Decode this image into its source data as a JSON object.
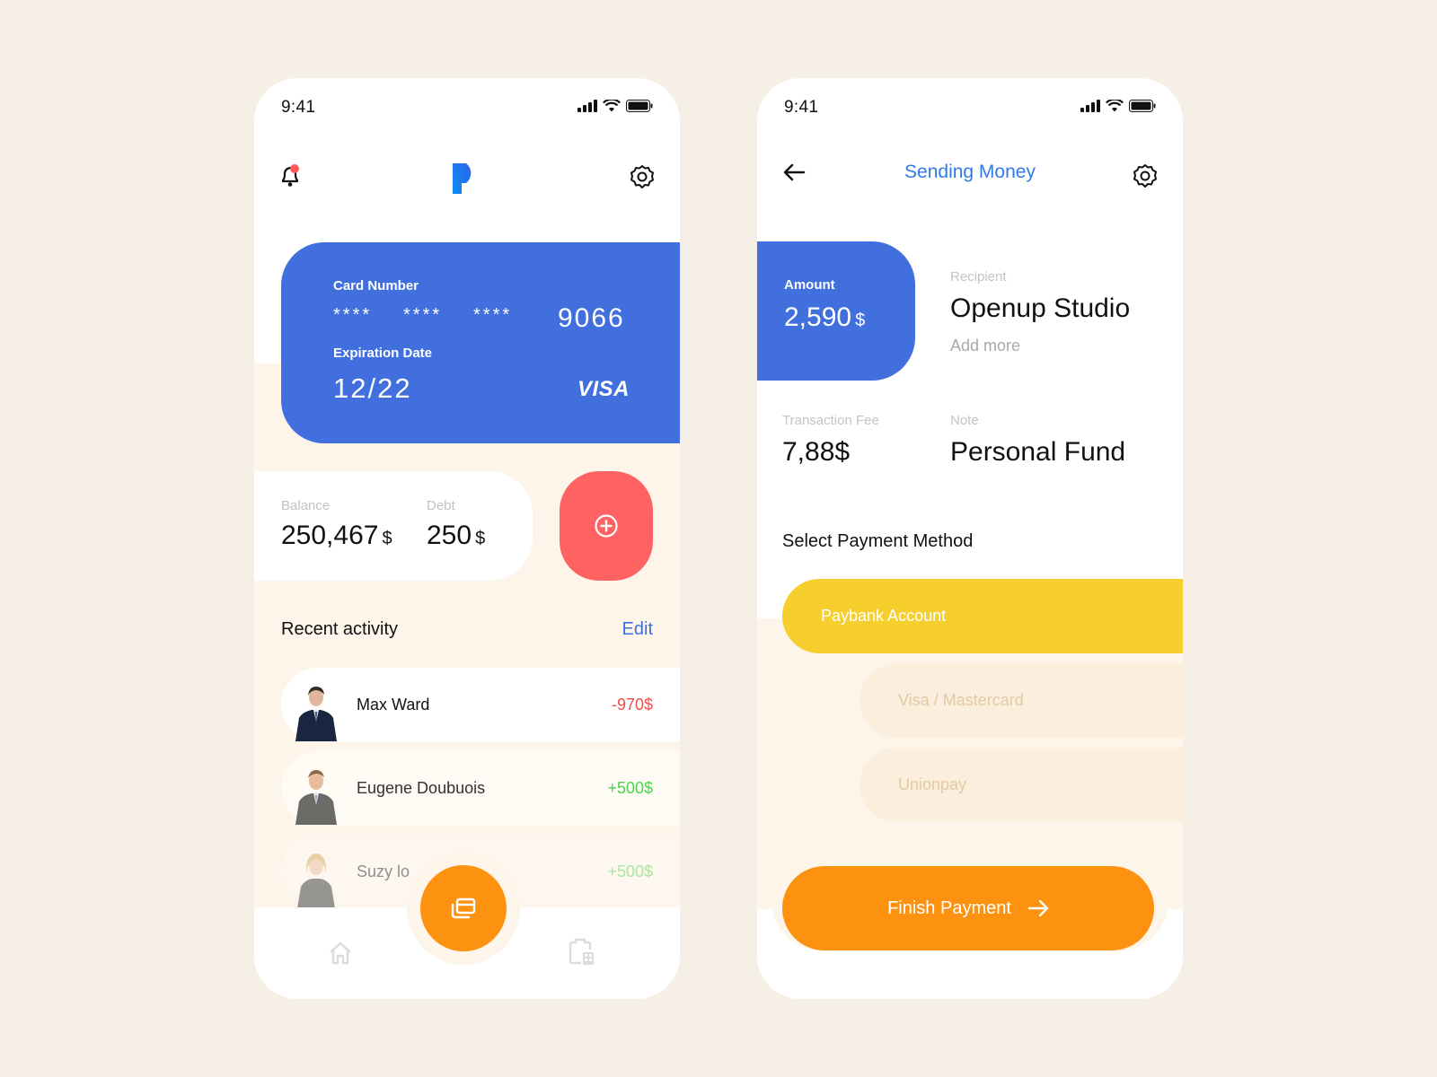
{
  "left_screen": {
    "status_bar": {
      "time": "9:41"
    },
    "header": {
      "notification_icon": "bell-icon",
      "logo_icon": "p-logo-icon",
      "settings_icon": "gear-icon"
    },
    "card": {
      "number_label": "Card Number",
      "masked_groups": [
        "****",
        "****",
        "****"
      ],
      "last_digits": "9066",
      "expiration_label": "Expiration Date",
      "expiration_value": "12/22",
      "brand": "VISA"
    },
    "balance": {
      "label": "Balance",
      "value": "250,467",
      "currency": "$"
    },
    "debt": {
      "label": "Debt",
      "value": "250",
      "currency": "$"
    },
    "add_button_icon": "plus-circle-icon",
    "recent_activity": {
      "title": "Recent activity",
      "edit_label": "Edit",
      "items": [
        {
          "name": "Max Ward",
          "amount": "-970$",
          "type": "debit"
        },
        {
          "name": "Eugene Doubuois",
          "amount": "+500$",
          "type": "credit"
        },
        {
          "name": "Suzy lo",
          "amount": "+500$",
          "type": "credit"
        }
      ]
    },
    "bottom_nav": {
      "items": [
        {
          "name": "home",
          "icon": "home-icon"
        },
        {
          "name": "cards",
          "icon": "cards-icon"
        },
        {
          "name": "calculator",
          "icon": "clipboard-calculator-icon"
        }
      ]
    }
  },
  "right_screen": {
    "status_bar": {
      "time": "9:41"
    },
    "header": {
      "back_icon": "arrow-left-icon",
      "title": "Sending Money",
      "settings_icon": "gear-icon"
    },
    "amount": {
      "label": "Amount",
      "value": "2,590",
      "currency": "$"
    },
    "recipient": {
      "label": "Recipient",
      "value": "Openup Studio",
      "add_more_label": "Add more"
    },
    "fee": {
      "label": "Transaction Fee",
      "value": "7,88",
      "currency": "$"
    },
    "note": {
      "label": "Note",
      "value": "Personal Fund"
    },
    "payment_method": {
      "title": "Select Payment Method",
      "options": [
        {
          "label": "Paybank Account",
          "selected": true
        },
        {
          "label": "Visa / Mastercard",
          "selected": false
        },
        {
          "label": "Unionpay",
          "selected": false
        }
      ]
    },
    "finish_button": {
      "label": "Finish Payment",
      "icon": "arrow-right-icon"
    }
  },
  "colors": {
    "page_bg": "#f6efe5",
    "brand_blue": "#4170de",
    "title_blue": "#2f7ae5",
    "danger_red": "#ff6262",
    "debit_red": "#f24b4b",
    "credit_green": "#4cd44c",
    "accent_orange": "#fd9210",
    "selected_yellow": "#f6cf2f",
    "soft_beige": "#fdf5ea"
  }
}
